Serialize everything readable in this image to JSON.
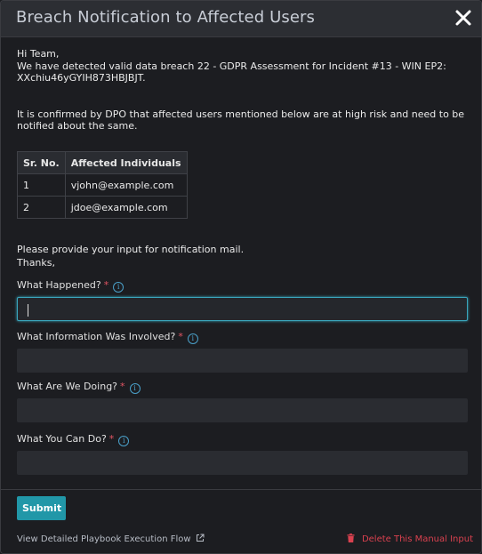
{
  "dialog": {
    "title": "Breach Notification to Affected Users",
    "close_icon": "close-icon"
  },
  "message": {
    "greeting": "Hi Team,",
    "line1": "We have detected valid data breach 22 - GDPR Assessment for Incident #13 - WIN EP2:",
    "line2": "XXchiu46yGYIH873HBJBJT.",
    "line3": "It is confirmed by DPO that affected users mentioned below are at high risk and need to be",
    "line4": "notified about the same.",
    "closing1": "Please provide your input for notification mail.",
    "closing2": "Thanks,"
  },
  "table": {
    "headers": [
      "Sr. No.",
      "Affected Individuals"
    ],
    "rows": [
      [
        "1",
        "vjohn@example.com"
      ],
      [
        "2",
        "jdoe@example.com"
      ]
    ]
  },
  "fields": [
    {
      "label": "What Happened?",
      "required": "*",
      "value": ""
    },
    {
      "label": "What Information Was Involved?",
      "required": "*",
      "value": ""
    },
    {
      "label": "What Are We Doing?",
      "required": "*",
      "value": ""
    },
    {
      "label": "What You Can Do?",
      "required": "*",
      "value": ""
    }
  ],
  "footer": {
    "submit_label": "Submit",
    "flow_link": "View Detailed Playbook Execution Flow",
    "delete_link": "Delete This Manual Input"
  },
  "colors": {
    "accent": "#2197a8",
    "danger": "#d9414f",
    "info": "#4aa0c9"
  }
}
